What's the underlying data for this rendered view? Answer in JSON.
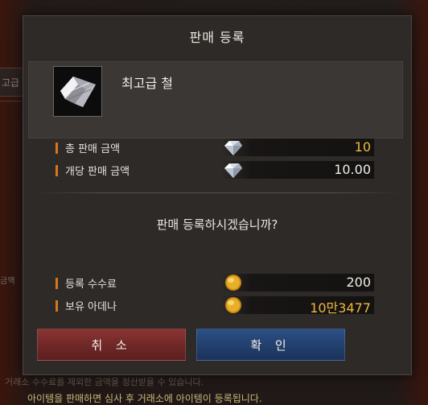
{
  "dialog": {
    "title": "판매 등록",
    "item_name": "최고급 철",
    "question": "판매 등록하시겠습니까?",
    "sale": [
      {
        "label": "총 판매 금액",
        "value": "10",
        "icon": "diamond-icon",
        "highlight": true
      },
      {
        "label": "개당 판매 금액",
        "value": "10.00",
        "icon": "diamond-icon",
        "highlight": false
      }
    ],
    "costs": [
      {
        "label": "등록 수수료",
        "value": "200",
        "icon": "adena-coin-icon",
        "highlight": false
      },
      {
        "label": "보유 아데나",
        "value": "10만3477",
        "icon": "adena-coin-icon",
        "highlight": true
      }
    ],
    "buttons": {
      "cancel": "취 소",
      "confirm": "확 인"
    }
  },
  "background": {
    "left_tab": "고급",
    "left_label": "금액",
    "bottom_line_1": "거래소 수수료를 제외한 금액을 정산받을 수 있습니다.",
    "bottom_line_2": "아이템을 판매하면 심사 후 거래소에 아이템이 등록됩니다."
  },
  "colors": {
    "accent_bar": "#d4781f",
    "gold_text": "#f0b840",
    "cancel_button": "#7a2e2d",
    "confirm_button": "#264a7d"
  }
}
